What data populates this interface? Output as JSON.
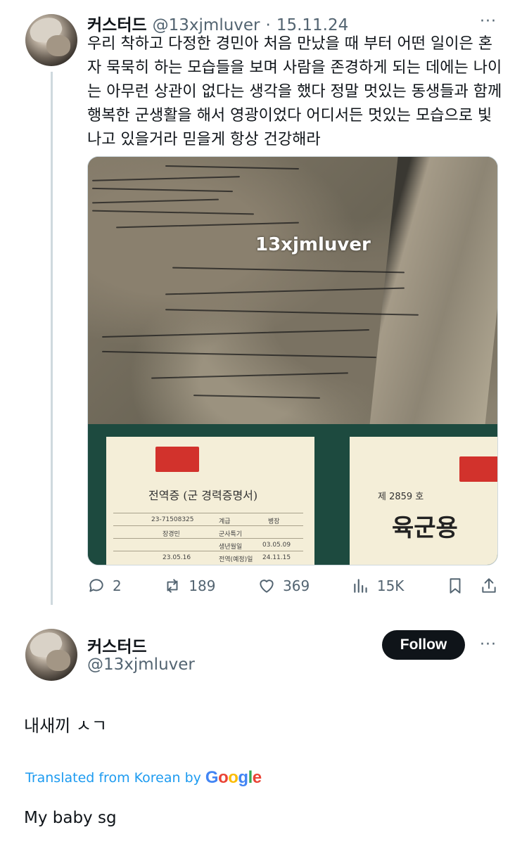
{
  "post1": {
    "name": "커스터드",
    "handle": "@13xjmluver",
    "separator": "·",
    "date": "15.11.24",
    "more": "···",
    "text": "우리 착하고 다정한 경민아 처음 만났을 때 부터 어떤 일이은 혼자 묵묵히 하는 모습들을 보며 사람을 존경하게 되는 데에는 나이는 아무런 상관이 없다는 생각을 했다 정말 멋있는 동생들과 함께 행복한 군생활을 해서 영광이었다 어디서든 멋있는 모습으로 빛나고 있을거라 믿을게 항상 건강해라",
    "image": {
      "watermark": "13xjmluver",
      "certificate_title": "전역증 (군 경력증명서)",
      "certificate_number": "제 2859 호",
      "certificate_heading": "육군용",
      "certificate_cells": [
        "23-71508325",
        "계급",
        "병장",
        "장경민",
        "군사특기",
        "생년월일",
        "03.05.09",
        "23.05.16",
        "전역(예정)일",
        "24.11.15"
      ]
    },
    "actions": {
      "replies": "2",
      "reposts": "189",
      "likes": "369",
      "views": "15K"
    }
  },
  "post2": {
    "name": "커스터드",
    "handle": "@13xjmluver",
    "follow_label": "Follow",
    "more": "···",
    "text": "내새끼 ㅅㄱ",
    "translated_label": "Translated from Korean by",
    "google": "Google",
    "translation": "My baby sg"
  },
  "colors": {
    "accent": "#1d9bf0",
    "text": "#0f1419",
    "muted": "#536471",
    "google_blue": "#4285F4",
    "google_red": "#EA4335",
    "google_yellow": "#FBBC05",
    "google_green": "#34A853"
  },
  "icons": [
    "reply-icon",
    "repost-icon",
    "like-icon",
    "views-icon",
    "bookmark-icon",
    "share-icon"
  ]
}
